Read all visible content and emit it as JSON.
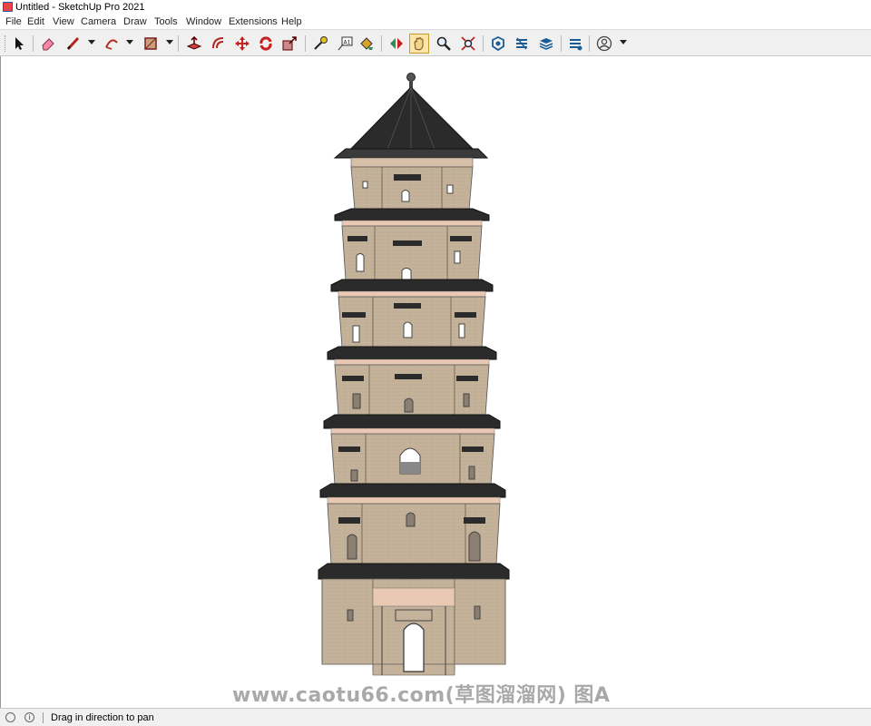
{
  "window": {
    "title": "Untitled - SketchUp Pro 2021"
  },
  "menu": [
    "File",
    "Edit",
    "View",
    "Camera",
    "Draw",
    "Tools",
    "Window",
    "Extensions",
    "Help"
  ],
  "toolbar": {
    "tools": [
      {
        "name": "select-tool-icon"
      },
      {
        "name": "eraser-tool-icon"
      },
      {
        "name": "line-tool-icon"
      },
      {
        "name": "arc-tool-icon"
      },
      {
        "name": "rectangle-tool-icon"
      },
      {
        "name": "push-pull-tool-icon"
      },
      {
        "name": "offset-tool-icon"
      },
      {
        "name": "move-tool-icon"
      },
      {
        "name": "rotate-tool-icon"
      },
      {
        "name": "scale-tool-icon"
      },
      {
        "name": "tape-measure-tool-icon"
      },
      {
        "name": "text-tool-icon"
      },
      {
        "name": "paint-bucket-tool-icon"
      },
      {
        "name": "orbit-tool-icon"
      },
      {
        "name": "pan-tool-icon"
      },
      {
        "name": "zoom-tool-icon"
      },
      {
        "name": "zoom-extents-tool-icon"
      },
      {
        "name": "warehouse-icon"
      },
      {
        "name": "extension-warehouse-icon"
      },
      {
        "name": "layout-icon"
      },
      {
        "name": "extension-manager-icon"
      },
      {
        "name": "account-icon"
      }
    ],
    "text_tool_glyph": "A1"
  },
  "status": {
    "text": "Drag in direction to pan",
    "info_glyph": "i"
  },
  "watermark": "www.caotu66.com(草图溜溜网) 图A",
  "colors": {
    "toolbar_bg": "#f0f0f0",
    "wall": "#c4b39a",
    "roof": "#2b2b2b",
    "trim": "#e9c9b4"
  }
}
